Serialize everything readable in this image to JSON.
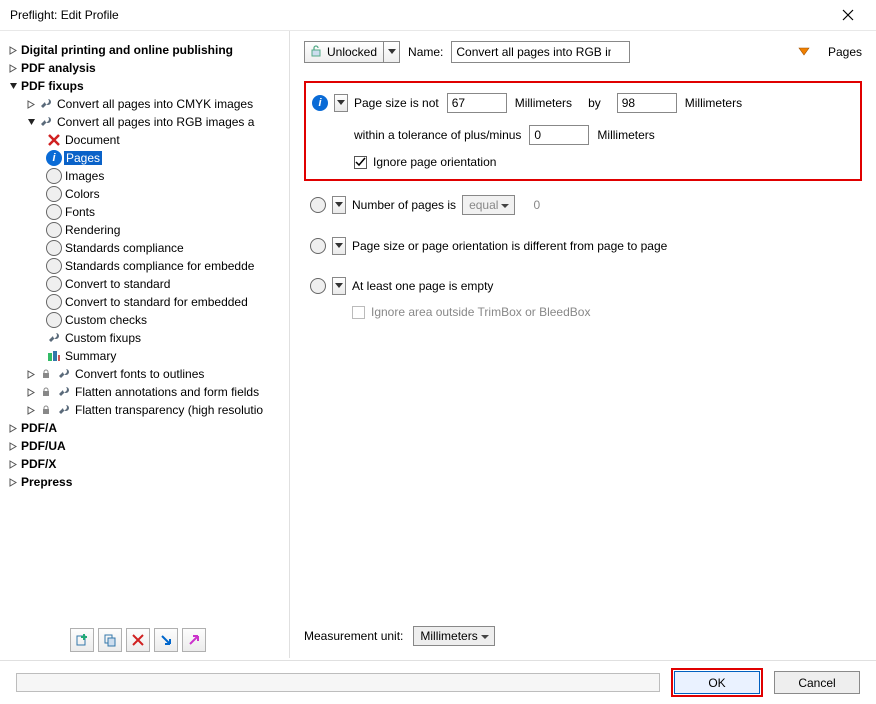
{
  "window": {
    "title": "Preflight: Edit Profile"
  },
  "tree": {
    "i0": "Digital printing and online publishing",
    "i1": "PDF analysis",
    "i2": "PDF fixups",
    "i2a": "Convert all pages into CMYK images",
    "i2b": "Convert all pages into RGB images a",
    "i2b_children": {
      "c0": "Document",
      "c1": "Pages",
      "c2": "Images",
      "c3": "Colors",
      "c4": "Fonts",
      "c5": "Rendering",
      "c6": "Standards compliance",
      "c7": "Standards compliance for embedde",
      "c8": "Convert to standard",
      "c9": "Convert to standard for embedded",
      "c10": "Custom checks",
      "c11": "Custom fixups",
      "c12": "Summary"
    },
    "i2c": "Convert fonts to outlines",
    "i2d": "Flatten annotations and form fields",
    "i2e": "Flatten transparency (high resolutio",
    "i3": "PDF/A",
    "i4": "PDF/UA",
    "i5": "PDF/X",
    "i6": "Prepress"
  },
  "top": {
    "unlocked": "Unlocked",
    "name_label": "Name:",
    "name_value": "Convert all pages into RGB images and preserve text informa",
    "pages": "Pages"
  },
  "panel1": {
    "label": "Page size is not",
    "width": "67",
    "unit1": "Millimeters",
    "by": "by",
    "height": "98",
    "unit2": "Millimeters",
    "tolerance_label": "within a tolerance of plus/minus",
    "tolerance": "0",
    "tol_unit": "Millimeters",
    "ignore": "Ignore page orientation"
  },
  "panel2": {
    "label": "Number of pages is",
    "mode": "equal",
    "value": "0"
  },
  "panel3": {
    "label": "Page size or page orientation is different from page to page"
  },
  "panel4": {
    "label": "At least one page is empty",
    "sub": "Ignore area outside TrimBox or BleedBox"
  },
  "measurement": {
    "label": "Measurement unit:",
    "unit": "Millimeters"
  },
  "footer": {
    "ok": "OK",
    "cancel": "Cancel"
  }
}
